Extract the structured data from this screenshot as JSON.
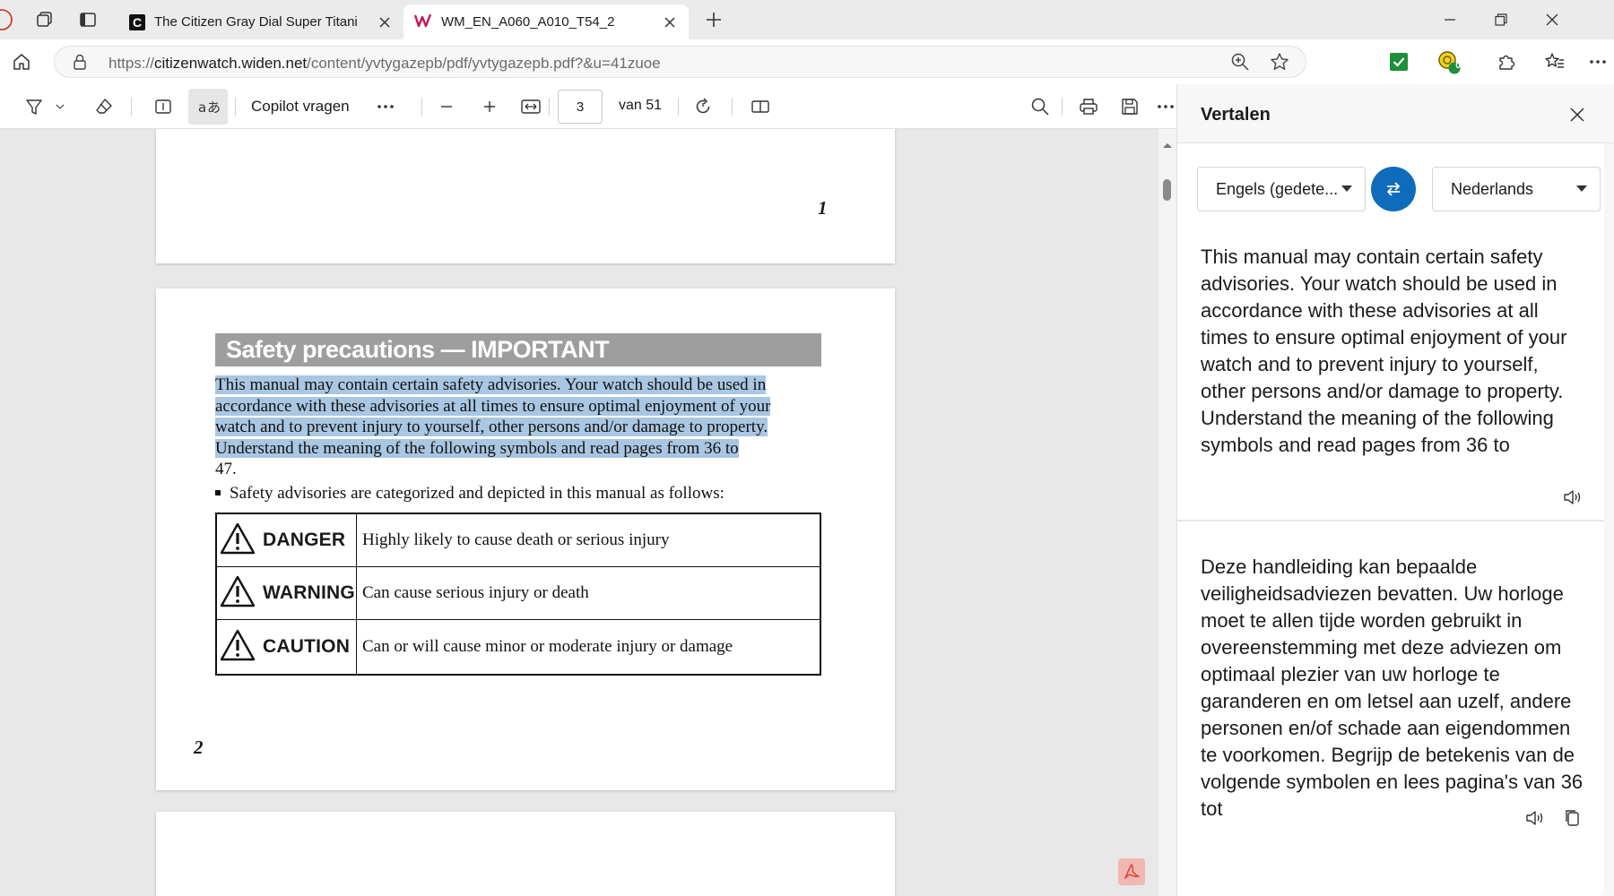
{
  "browser": {
    "tabs": [
      {
        "title": "The Citizen Gray Dial Super Titani",
        "favicon_letter": "C",
        "active": false
      },
      {
        "title": "WM_EN_A060_A010_T54_2",
        "active": true
      }
    ],
    "address": {
      "url_prefix": "https://",
      "url_host": "citizenwatch.widen.net",
      "url_path": "/content/yvtygazepb/pdf/yvtygazepb.pdf?&u=41zuoe"
    },
    "extension_badge": "0"
  },
  "pdf_toolbar": {
    "copilot_label": "Copilot vragen",
    "current_page": "3",
    "page_total_label": "van 51"
  },
  "document": {
    "page1_number": "1",
    "page2_number": "2",
    "section_title": "Safety precautions — IMPORTANT",
    "paragraph_lines": [
      "This manual may contain certain safety advisories. Your watch should be used in",
      "accordance with these advisories at all times to ensure optimal enjoyment of your",
      "watch and to prevent injury to yourself, other persons and/or damage to property.",
      "Understand the meaning of the following symbols and read pages from 36 to"
    ],
    "paragraph_tail": "47.",
    "bullet_text": "Safety advisories are categorized and depicted in this manual as follows:",
    "advisories": [
      {
        "level": "DANGER",
        "description": "Highly likely to cause death or serious injury"
      },
      {
        "level": "WARNING",
        "description": "Can cause serious injury or death"
      },
      {
        "level": "CAUTION",
        "description": "Can or will cause minor or moderate injury or damage"
      }
    ]
  },
  "translate_pane": {
    "title": "Vertalen",
    "source_language": "Engels (gedete...",
    "target_language": "Nederlands",
    "source_text": "This manual may contain certain safety advisories. Your watch should be used in accordance with these advisories at all times to ensure optimal enjoyment of your watch and to prevent injury to yourself, other persons and/or damage to property. Understand the meaning of the following symbols and read pages from 36 to",
    "translated_text": "Deze handleiding kan bepaalde veiligheidsadviezen bevatten. Uw horloge moet te allen tijde worden gebruikt in overeenstemming met deze adviezen om optimaal plezier van uw horloge te garanderen en om letsel aan uzelf, andere personen en/of schade aan eigendommen te voorkomen. Begrijp de betekenis van de volgende symbolen en lees pagina's van 36 tot"
  },
  "colors": {
    "accent": "#0f6cbd",
    "selection_highlight": "#a9c6e2",
    "section_header_bg": "#9e9e9e",
    "pdf_logo": "#e0473f"
  }
}
